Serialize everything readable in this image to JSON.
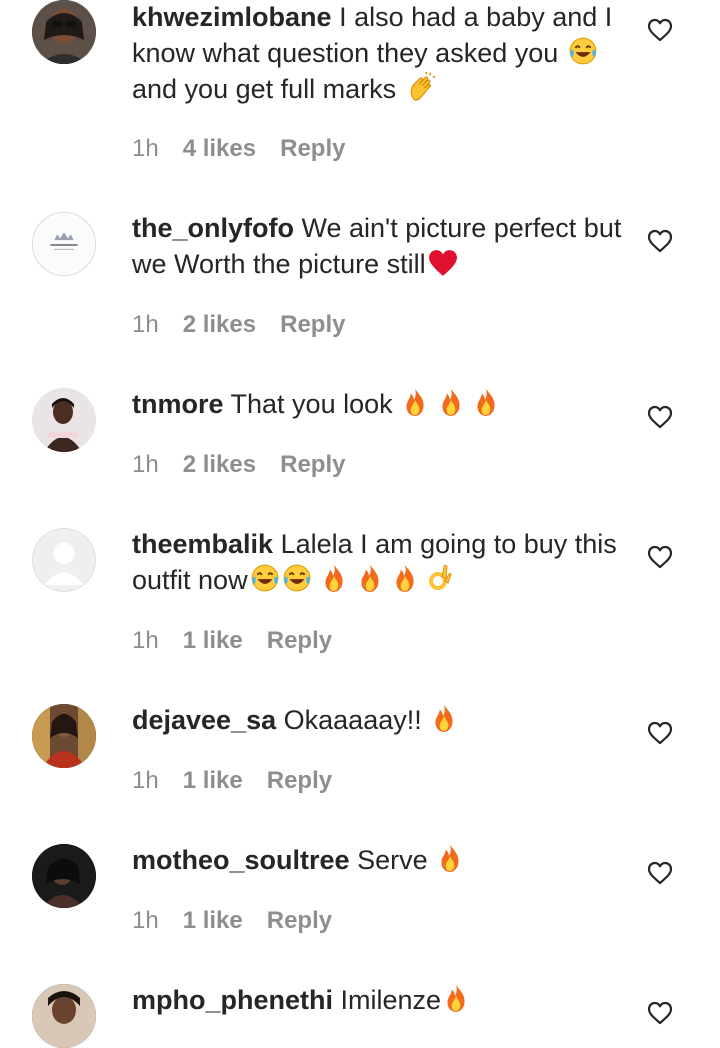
{
  "comments": [
    {
      "username": "khwezimlobane",
      "text": "I also had a baby and I know what question they asked you",
      "text_after": "and you get full marks",
      "time": "1h",
      "likes": "4 likes",
      "reply": "Reply"
    },
    {
      "username": "the_onlyfofo",
      "text": "We ain't picture perfect but we Worth the picture still",
      "time": "1h",
      "likes": "2 likes",
      "reply": "Reply"
    },
    {
      "username": "tnmore",
      "text": "That you look",
      "time": "1h",
      "likes": "2 likes",
      "reply": "Reply"
    },
    {
      "username": "theembalik",
      "text": "Lalela I am going to buy this outfit now",
      "time": "1h",
      "likes": "1 like",
      "reply": "Reply"
    },
    {
      "username": "dejavee_sa",
      "text": "Okaaaaay!!",
      "time": "1h",
      "likes": "1 like",
      "reply": "Reply"
    },
    {
      "username": "motheo_soultree",
      "text": "Serve",
      "time": "1h",
      "likes": "1 like",
      "reply": "Reply"
    },
    {
      "username": "mpho_phenethi",
      "text": "Imilenze"
    }
  ],
  "icons": {
    "like": "heart-outline-icon",
    "fire": "fire-emoji",
    "laugh": "tears-of-joy-emoji",
    "clap": "clapping-hands-emoji",
    "heart": "red-heart-emoji",
    "ok": "ok-hand-emoji"
  },
  "colors": {
    "text": "#262626",
    "meta": "#8e8e8e",
    "red_heart": "#e0102e"
  }
}
